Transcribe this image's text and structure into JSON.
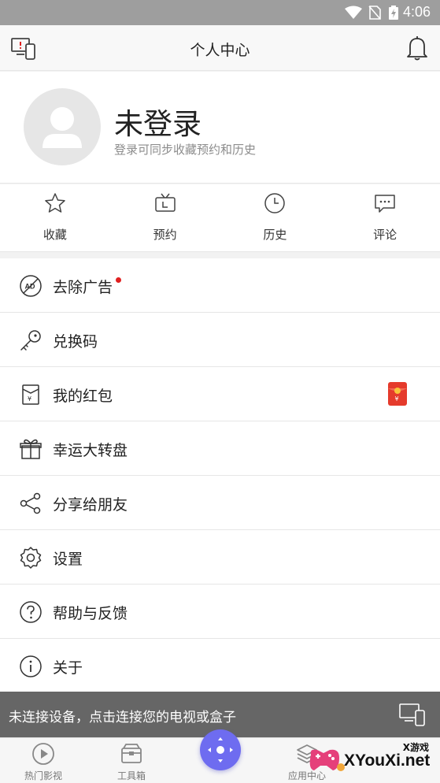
{
  "status_bar": {
    "time": "4:06"
  },
  "header": {
    "title": "个人中心"
  },
  "profile": {
    "name": "未登录",
    "subtitle": "登录可同步收藏预约和历史"
  },
  "quick_actions": [
    {
      "label": "收藏",
      "icon": "star-icon"
    },
    {
      "label": "预约",
      "icon": "tv-icon"
    },
    {
      "label": "历史",
      "icon": "clock-icon"
    },
    {
      "label": "评论",
      "icon": "comment-icon"
    }
  ],
  "menu": [
    {
      "label": "去除广告",
      "icon": "ad-block-icon",
      "has_red_dot": true
    },
    {
      "label": "兑换码",
      "icon": "key-icon"
    },
    {
      "label": "我的红包",
      "icon": "red-envelope-icon",
      "badge_icon": "red-envelope-badge-icon"
    },
    {
      "label": "幸运大转盘",
      "icon": "gift-icon"
    },
    {
      "label": "分享给朋友",
      "icon": "share-icon"
    },
    {
      "label": "设置",
      "icon": "gear-icon"
    },
    {
      "label": "帮助与反馈",
      "icon": "help-icon"
    },
    {
      "label": "关于",
      "icon": "info-icon"
    }
  ],
  "connect_banner": {
    "text": "未连接设备，点击连接您的电视或盒子"
  },
  "bottom_nav": [
    {
      "label": "热门影视",
      "icon": "play-icon"
    },
    {
      "label": "工具箱",
      "icon": "toolbox-icon"
    },
    {
      "label": "应用中心",
      "icon": "layers-icon"
    }
  ],
  "watermark": {
    "small": "X游戏",
    "big": "XYouXi.net"
  },
  "colors": {
    "accent": "#6e6cf0",
    "red_dot": "#e02020",
    "banner_bg": "#666666",
    "status_bg": "#9e9e9e"
  }
}
